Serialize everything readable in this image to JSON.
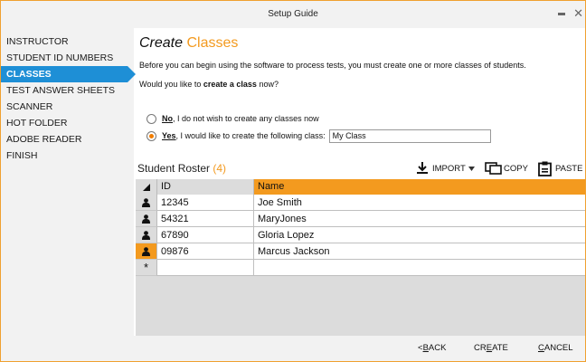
{
  "window": {
    "title": "Setup Guide"
  },
  "sidebar": {
    "items": [
      {
        "label": "INSTRUCTOR",
        "active": false
      },
      {
        "label": "STUDENT ID NUMBERS",
        "active": false
      },
      {
        "label": "CLASSES",
        "active": true
      },
      {
        "label": "TEST ANSWER SHEETS",
        "active": false
      },
      {
        "label": "SCANNER",
        "active": false
      },
      {
        "label": "HOT FOLDER",
        "active": false
      },
      {
        "label": "ADOBE READER",
        "active": false
      },
      {
        "label": "FINISH",
        "active": false
      }
    ]
  },
  "main": {
    "heading_italic": "Create",
    "heading_accent": "Classes",
    "intro": "Before you can begin using the software to process tests, you must create one or more classes of students.",
    "question_prefix": "Would you like to ",
    "question_bold": "create a class",
    "question_suffix": " now?",
    "option_no": {
      "key": "No",
      "rest": ", I do not wish to create any classes now",
      "selected": false
    },
    "option_yes": {
      "key": "Yes",
      "rest": ", I would like to create the following class:",
      "selected": true,
      "class_name": "My Class"
    }
  },
  "roster": {
    "title": "Student Roster",
    "count": "(4)",
    "toolbar": {
      "import": "IMPORT",
      "copy": "COPY",
      "paste": "PASTE"
    },
    "columns": {
      "id": "ID",
      "name": "Name"
    },
    "rows": [
      {
        "id": "12345",
        "name": "Joe Smith",
        "current": false
      },
      {
        "id": "54321",
        "name": "MaryJones",
        "current": false
      },
      {
        "id": "67890",
        "name": "Gloria Lopez",
        "current": false
      },
      {
        "id": "09876",
        "name": "Marcus Jackson",
        "current": true
      }
    ],
    "new_row_marker": "*"
  },
  "footer": {
    "back": {
      "pre": "<",
      "key": "B",
      "rest": "ACK"
    },
    "create": {
      "pre": "CR",
      "key": "E",
      "rest": "ATE"
    },
    "cancel": {
      "pre": "",
      "key": "C",
      "rest": "ANCEL"
    }
  },
  "colors": {
    "accent": "#f39a1f",
    "active_nav": "#1e8fd6",
    "radio_dot": "#f07d00"
  },
  "icons": [
    "minimize-icon",
    "close-icon",
    "import-icon",
    "dropdown-arrow-icon",
    "copy-icon",
    "paste-icon",
    "grid-corner-icon",
    "person-icon",
    "new-row-icon"
  ]
}
